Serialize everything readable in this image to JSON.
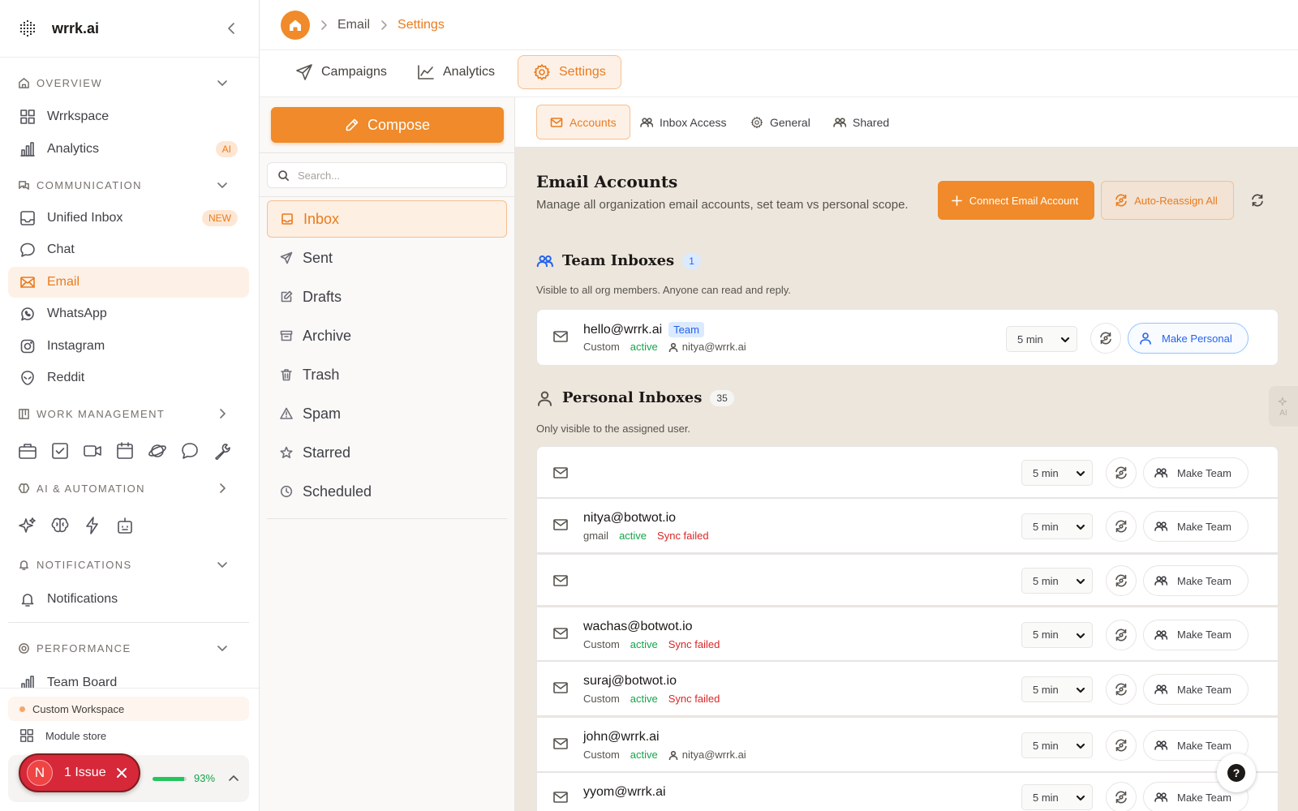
{
  "brand": {
    "name": "wrrk.ai"
  },
  "sidebar": {
    "overview": {
      "title": "OVERVIEW",
      "items": [
        {
          "label": "Wrrkspace"
        },
        {
          "label": "Analytics",
          "badge": "AI"
        }
      ]
    },
    "communication": {
      "title": "COMMUNICATION",
      "items": [
        {
          "label": "Unified Inbox",
          "badge": "NEW"
        },
        {
          "label": "Chat"
        },
        {
          "label": "Email",
          "active": true
        },
        {
          "label": "WhatsApp"
        },
        {
          "label": "Instagram"
        },
        {
          "label": "Reddit"
        }
      ]
    },
    "work_management": {
      "title": "WORK MANAGEMENT",
      "icons": [
        "briefcase-icon",
        "checkbox-icon",
        "video-icon",
        "calendar-icon",
        "planet-icon",
        "chat-bubble-icon",
        "wrench-icon"
      ]
    },
    "ai_automation": {
      "title": "AI & AUTOMATION",
      "icons": [
        "sparkles-icon",
        "brain-icon",
        "bolt-icon",
        "robot-icon"
      ]
    },
    "notifications": {
      "title": "NOTIFICATIONS",
      "items": [
        {
          "label": "Notifications"
        }
      ]
    },
    "performance": {
      "title": "PERFORMANCE",
      "items": [
        {
          "label": "Team Board"
        }
      ]
    },
    "custom_workspace": "Custom Workspace",
    "module_store": "Module store",
    "progress": {
      "value": 0.93,
      "label": "93%"
    },
    "issue": {
      "avatar": "N",
      "label": "1 Issue"
    }
  },
  "breadcrumb": {
    "items": [
      "Email",
      "Settings"
    ]
  },
  "tabs": [
    {
      "label": "Campaigns"
    },
    {
      "label": "Analytics"
    },
    {
      "label": "Settings",
      "active": true
    }
  ],
  "mail": {
    "compose": "Compose",
    "search_placeholder": "Search...",
    "folders": [
      {
        "label": "Inbox",
        "active": true,
        "icon": "inbox-icon"
      },
      {
        "label": "Sent",
        "icon": "send-icon"
      },
      {
        "label": "Drafts",
        "icon": "edit-icon"
      },
      {
        "label": "Archive",
        "icon": "archive-icon"
      },
      {
        "label": "Trash",
        "icon": "trash-icon"
      },
      {
        "label": "Spam",
        "icon": "warning-icon"
      },
      {
        "label": "Starred",
        "icon": "star-icon"
      },
      {
        "label": "Scheduled",
        "icon": "clock-icon"
      }
    ]
  },
  "settings": {
    "subtabs": [
      {
        "label": "Accounts",
        "active": true
      },
      {
        "label": "Inbox Access"
      },
      {
        "label": "General"
      },
      {
        "label": "Shared"
      }
    ],
    "title": "Email Accounts",
    "description": "Manage all organization email accounts, set team vs personal scope.",
    "connect_label": "Connect Email Account",
    "reassign_label": "Auto-Reassign All",
    "team": {
      "title": "Team Inboxes",
      "count": "1",
      "subtitle": "Visible to all org members. Anyone can read and reply.",
      "accounts": [
        {
          "email": "hello@wrrk.ai",
          "badge": "Team",
          "provider": "Custom",
          "status": "active",
          "owner": "nitya@wrrk.ai",
          "interval": "5 min",
          "action": "Make Personal"
        }
      ]
    },
    "personal": {
      "title": "Personal Inboxes",
      "count": "35",
      "subtitle": "Only visible to the assigned user.",
      "accounts": [
        {
          "email": "",
          "provider": "",
          "status": "",
          "error": "",
          "owner": "",
          "interval": "5 min",
          "action": "Make Team"
        },
        {
          "email": "nitya@botwot.io",
          "provider": "gmail",
          "status": "active",
          "error": "Sync failed",
          "owner": "",
          "interval": "5 min",
          "action": "Make Team"
        },
        {
          "email": "",
          "provider": "",
          "status": "",
          "error": "",
          "owner": "",
          "interval": "5 min",
          "action": "Make Team"
        },
        {
          "email": "wachas@botwot.io",
          "provider": "Custom",
          "status": "active",
          "error": "Sync failed",
          "owner": "",
          "interval": "5 min",
          "action": "Make Team"
        },
        {
          "email": "suraj@botwot.io",
          "provider": "Custom",
          "status": "active",
          "error": "Sync failed",
          "owner": "",
          "interval": "5 min",
          "action": "Make Team"
        },
        {
          "email": "john@wrrk.ai",
          "provider": "Custom",
          "status": "active",
          "error": "",
          "owner": "nitya@wrrk.ai",
          "interval": "5 min",
          "action": "Make Team"
        },
        {
          "email": "yyom@wrrk.ai",
          "provider": "",
          "status": "",
          "error": "",
          "owner": "",
          "interval": "5 min",
          "action": "Make Team"
        }
      ]
    }
  },
  "help": {
    "label": "?"
  },
  "ai_tab": {
    "label": "AI"
  },
  "colors": {
    "accent": "#f08a2a",
    "accent_text": "#ea7b1d",
    "success": "#16a34a",
    "error": "#dc2626",
    "info": "#2563eb",
    "pane_bg": "#ede6dd"
  }
}
